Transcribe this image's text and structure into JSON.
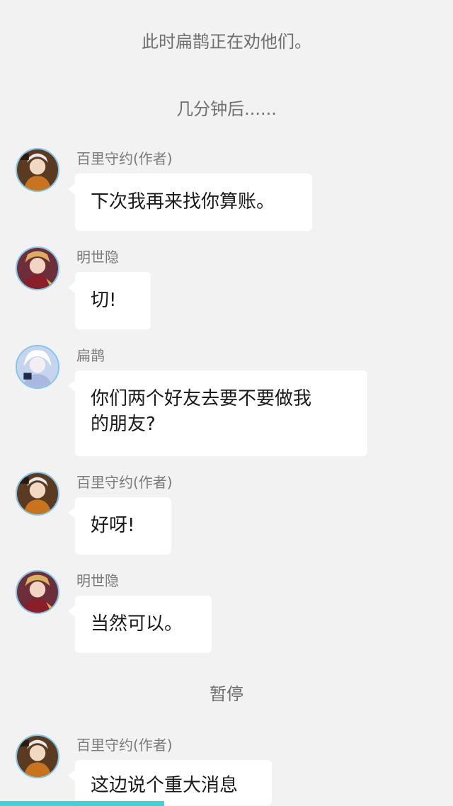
{
  "narrations": {
    "first": "此时扁鹊正在劝他们。",
    "second": "几分钟后......",
    "third": "暂停"
  },
  "messages": [
    {
      "sender": "百里守约(作者)",
      "text": "下次我再来找你算账。",
      "avatar": "baili-shouyue-avatar"
    },
    {
      "sender": "明世隐",
      "text": "切!",
      "avatar": "ming-shiyin-avatar"
    },
    {
      "sender": "扁鹊",
      "text_line1": "你们两个好友去要不要做我",
      "text_line2": "的朋友?",
      "avatar": "bian-que-avatar"
    },
    {
      "sender": "百里守约(作者)",
      "text": "好呀!",
      "avatar": "baili-shouyue-avatar"
    },
    {
      "sender": "明世隐",
      "text": "当然可以。",
      "avatar": "ming-shiyin-avatar"
    },
    {
      "sender": "百里守约(作者)",
      "text": "这边说个重大消息",
      "avatar": "baili-shouyue-avatar"
    }
  ],
  "colors": {
    "background": "#f2f2f2",
    "bubble": "#ffffff",
    "avatar_ring": "#7ec6ea",
    "progress_bar": "#3fd2d6"
  }
}
